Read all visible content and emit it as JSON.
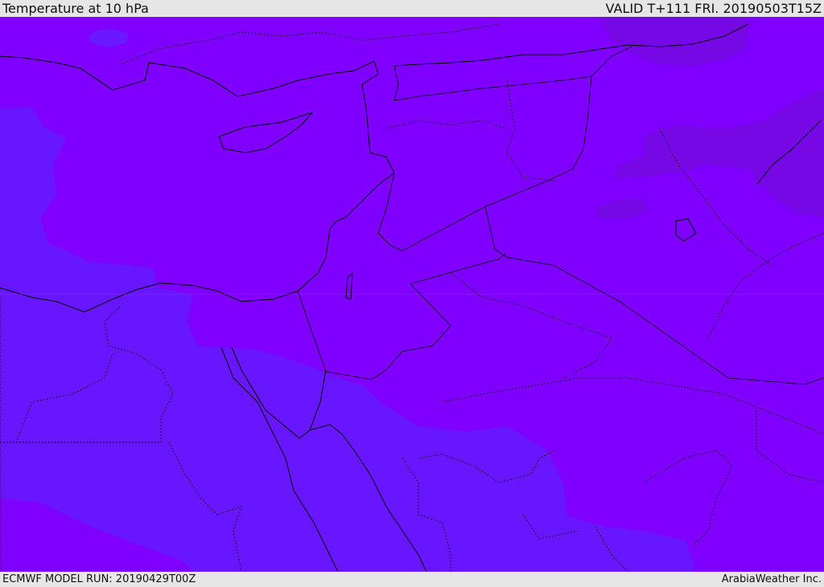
{
  "header": {
    "title": "Temperature at 10 hPa",
    "valid_time": "VALID T+111 FRI. 20190503T15Z"
  },
  "footer": {
    "model_run": "ECMWF MODEL RUN: 20190429T00Z",
    "credit": "ArabiaWeather Inc."
  },
  "colors": {
    "base_field": "#7f00ff",
    "cooler_field": "#6816ff",
    "warmer_patch": "#7608e6",
    "lines": "#000000"
  }
}
